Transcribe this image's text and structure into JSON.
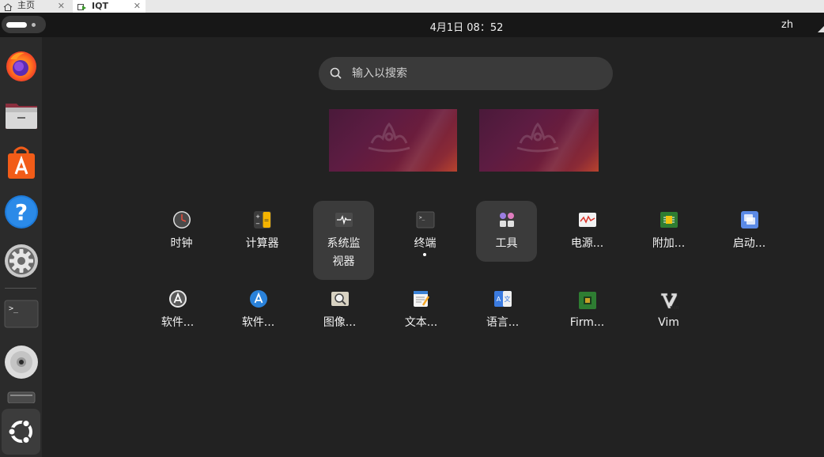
{
  "host_tabs": [
    {
      "label": "主页",
      "icon": "home-icon"
    },
    {
      "label": "IQT",
      "icon": "vm-icon"
    }
  ],
  "topbar": {
    "clock": "4月1日  08：52",
    "language": "zh"
  },
  "dock": {
    "items": [
      {
        "name": "firefox",
        "icon": "firefox-icon"
      },
      {
        "name": "files",
        "icon": "folder-icon"
      },
      {
        "name": "app-center",
        "icon": "store-icon"
      },
      {
        "name": "help",
        "icon": "help-icon"
      },
      {
        "name": "settings",
        "icon": "gear-icon"
      },
      {
        "name": "terminal",
        "icon": "terminal-icon"
      },
      {
        "name": "disc",
        "icon": "disc-icon"
      },
      {
        "name": "drive",
        "icon": "drive-icon"
      },
      {
        "name": "show-apps",
        "icon": "ubuntu-icon"
      }
    ]
  },
  "search": {
    "placeholder": "输入以搜索"
  },
  "apps_row1": [
    {
      "label": "时钟",
      "icon": "clock-icon"
    },
    {
      "label": "计算器",
      "icon": "calculator-icon"
    },
    {
      "label_line1": "系统监",
      "label_line2": "视器",
      "icon": "system-monitor-icon"
    },
    {
      "label": "终端",
      "icon": "terminal-icon"
    },
    {
      "label": "工具",
      "icon": "utilities-folder-icon"
    },
    {
      "label": "电源...",
      "icon": "power-statistics-icon"
    },
    {
      "label": "附加...",
      "icon": "additional-drivers-icon"
    },
    {
      "label": "启动...",
      "icon": "startup-disk-icon"
    }
  ],
  "apps_row2": [
    {
      "label": "软件...",
      "icon": "software-updater-icon"
    },
    {
      "label": "软件...",
      "icon": "app-store-icon"
    },
    {
      "label": "图像...",
      "icon": "image-viewer-icon"
    },
    {
      "label": "文本...",
      "icon": "text-editor-icon"
    },
    {
      "label": "语言...",
      "icon": "language-support-icon"
    },
    {
      "label": "Firm...",
      "icon": "firmware-icon"
    },
    {
      "label": "Vim",
      "icon": "vim-icon"
    }
  ]
}
